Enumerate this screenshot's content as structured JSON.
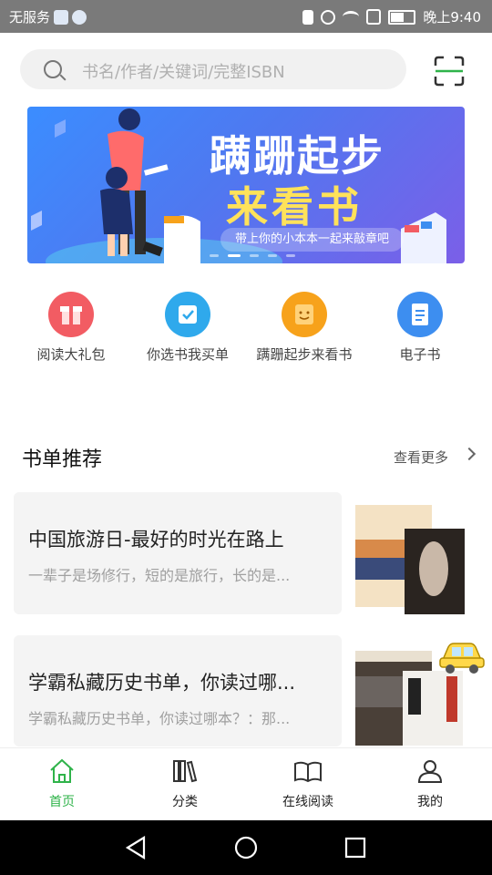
{
  "status_bar": {
    "carrier": "无服务",
    "time": "晚上9:40"
  },
  "search": {
    "placeholder": "书名/作者/关键词/完整ISBN"
  },
  "banner": {
    "title_line1": "蹒跚起步",
    "title_line2": "来看书",
    "tagline": "带上你的小本本一起来敲章吧",
    "active_dot": 2
  },
  "quick_actions": [
    {
      "label": "阅读大礼包",
      "icon": "gift-icon",
      "color": "#f25c63"
    },
    {
      "label": "你选书我买单",
      "icon": "checkbox-icon",
      "color": "#2fa9ec"
    },
    {
      "label": "蹒跚起步来看书",
      "icon": "smiley-book-icon",
      "color": "#f7a21b"
    },
    {
      "label": "电子书",
      "icon": "document-icon",
      "color": "#3d8ef0"
    }
  ],
  "section": {
    "title": "书单推荐",
    "more": "查看更多"
  },
  "booklists": [
    {
      "title": "中国旅游日-最好的时光在路上",
      "subtitle": "一辈子是场修行，短的是旅行，长的是..."
    },
    {
      "title": "学霸私藏历史书单，你读过哪...",
      "subtitle": "学霸私藏历史书单，你读过哪本？：那..."
    }
  ],
  "bottom_nav": [
    {
      "label": "首页",
      "icon": "home-icon",
      "active": true
    },
    {
      "label": "分类",
      "icon": "books-icon",
      "active": false
    },
    {
      "label": "在线阅读",
      "icon": "open-book-icon",
      "active": false
    },
    {
      "label": "我的",
      "icon": "user-icon",
      "active": false
    }
  ],
  "colors": {
    "accent": "#2fb34a",
    "banner_start": "#3b8dff",
    "banner_end": "#7b5fe8"
  }
}
